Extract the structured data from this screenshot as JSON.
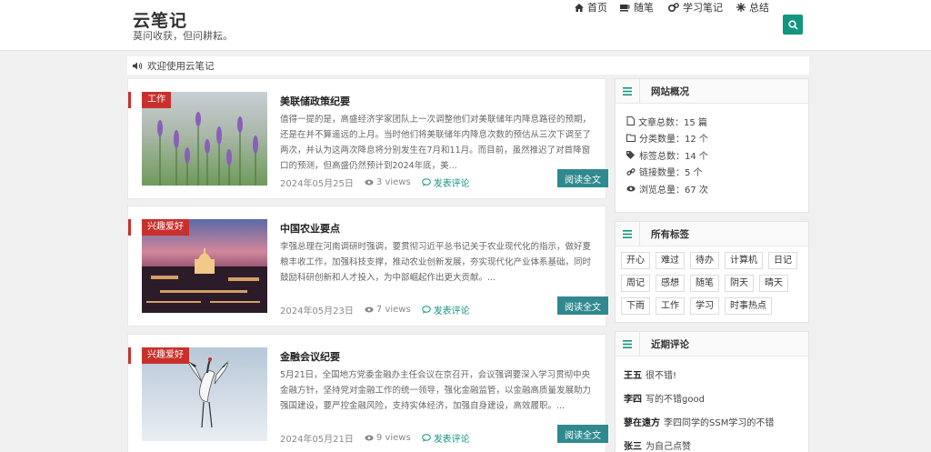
{
  "brand": {
    "title": "云笔记",
    "subtitle": "莫问收获，但问耕耘。"
  },
  "nav": [
    {
      "label": "首页",
      "icon": "home-icon"
    },
    {
      "label": "随笔",
      "icon": "coffee-icon"
    },
    {
      "label": "学习笔记",
      "icon": "gears-icon"
    },
    {
      "label": "总结",
      "icon": "snowflake-icon"
    }
  ],
  "search": {
    "icon": "search-icon"
  },
  "notice": {
    "text": "欢迎使用云笔记",
    "icon": "volume-icon"
  },
  "articles": [
    {
      "tag": "工作",
      "title": "美联储政策纪要",
      "summary": "值得一提的是，高盛经济学家团队上一次调整他们对美联储年内降息路径的预期，还是在并不算遥远的上月。当时他们将美联储年内降息次数的预估从三次下调至了两次，并认为这两次降息将分别发生在7月和11月。而目前，虽然推迟了对首降窗口的预测，但高盛仍然预计到2024年底，美...",
      "date": "2024年05月25日",
      "views": "3 views",
      "comment": "发表评论",
      "read": "阅读全文"
    },
    {
      "tag": "兴趣爱好",
      "title": "中国农业要点",
      "summary": "李强总理在河南调研时强调，要贯彻习近平总书记关于农业现代化的指示，做好夏粮丰收工作，加强科技支撑，推动农业创新发展，夯实现代化产业体系基础，同时鼓励科研创新和人才投入，为中部崛起作出更大贡献。...",
      "date": "2024年05月23日",
      "views": "7 views",
      "comment": "发表评论",
      "read": "阅读全文"
    },
    {
      "tag": "兴趣爱好",
      "title": "金融会议纪要",
      "summary": "5月21日，全国地方党委金融办主任会议在京召开，会议强调要深入学习贯彻中央金融方针，坚持党对金融工作的统一领导，强化金融监管，以金融高质量发展助力强国建设，要严控金融风险，支持实体经济，加强自身建设，高效履职。...",
      "date": "2024年05月21日",
      "views": "9 views",
      "comment": "发表评论",
      "read": "阅读全文"
    }
  ],
  "site_stats": {
    "title": "网站概况",
    "rows": [
      {
        "label": "文章总数：15 篇",
        "icon": "file-icon"
      },
      {
        "label": "分类数量：12 个",
        "icon": "folder-icon"
      },
      {
        "label": "标签总数：14 个",
        "icon": "tags-icon"
      },
      {
        "label": "链接数量：5 个",
        "icon": "link-icon"
      },
      {
        "label": "浏览总量：67 次",
        "icon": "eye-icon"
      }
    ]
  },
  "all_tags": {
    "title": "所有标签",
    "items": [
      "开心",
      "难过",
      "待办",
      "计算机",
      "日记",
      "周记",
      "感想",
      "随笔",
      "阴天",
      "晴天",
      "下雨",
      "工作",
      "学习",
      "时事热点"
    ]
  },
  "recent_comments": {
    "title": "近期评论",
    "items": [
      {
        "user": "王五",
        "text": "很不错!"
      },
      {
        "user": "李四",
        "text": "写的不错good"
      },
      {
        "user": "蓼在遠方",
        "text": "李四同学的SSM学习的不错"
      },
      {
        "user": "张三",
        "text": "为自己点赞"
      }
    ]
  },
  "colors": {
    "accent": "#129680",
    "tag_red": "#c9302c",
    "read_btn": "#30898f"
  }
}
